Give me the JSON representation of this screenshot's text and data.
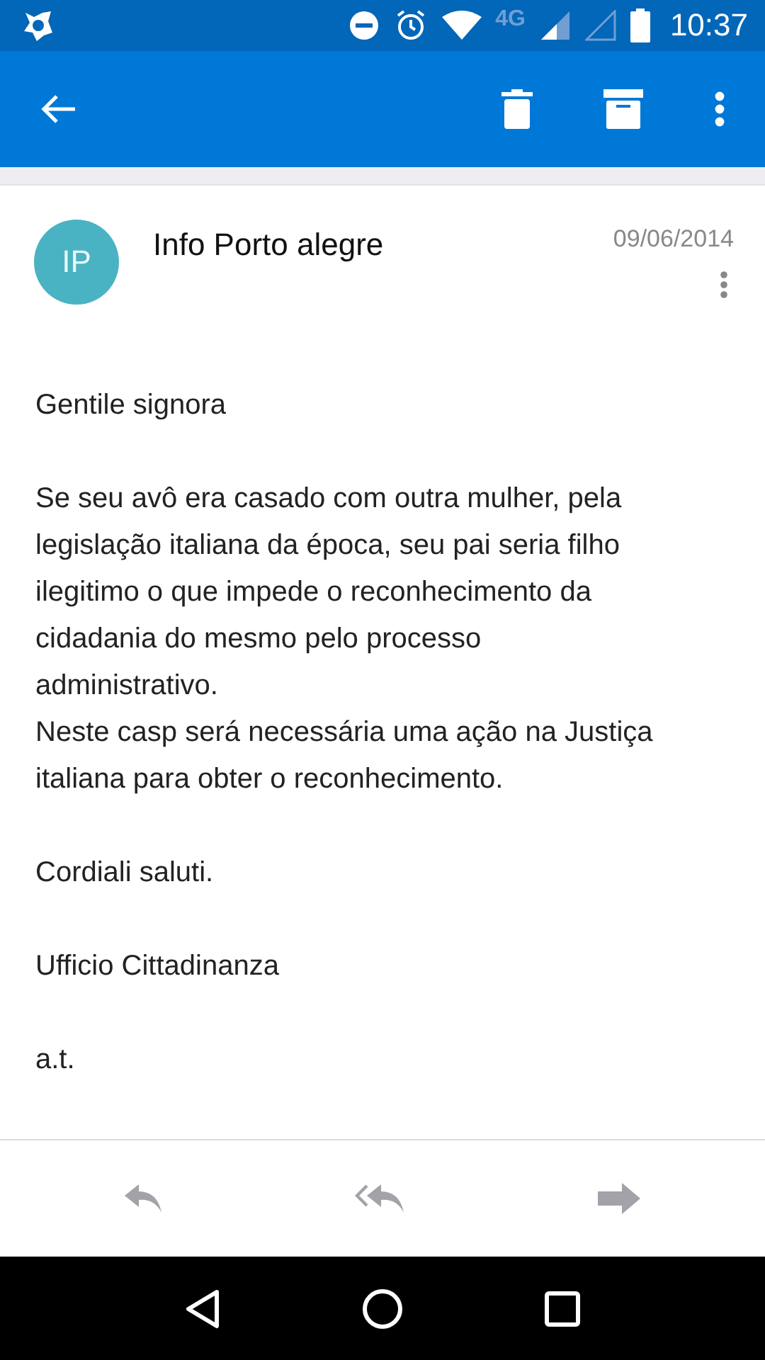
{
  "status_bar": {
    "network": "4G",
    "time": "10:37"
  },
  "message": {
    "avatar_initials": "IP",
    "sender": "Info Porto alegre",
    "date": "09/06/2014",
    "paragraphs": [
      [
        "Gentile signora"
      ],
      [
        "Se seu avô era casado com outra mulher, pela legislação italiana da época, seu pai seria filho ilegitimo o que impede o reconhecimento da cidadania do mesmo pelo processo administrativo.",
        "Neste casp será necessária uma ação na Justiça italiana para obter o reconhecimento."
      ],
      [
        "Cordiali saluti."
      ],
      [
        "Ufficio Cittadinanza"
      ],
      [
        "a.t."
      ]
    ]
  }
}
